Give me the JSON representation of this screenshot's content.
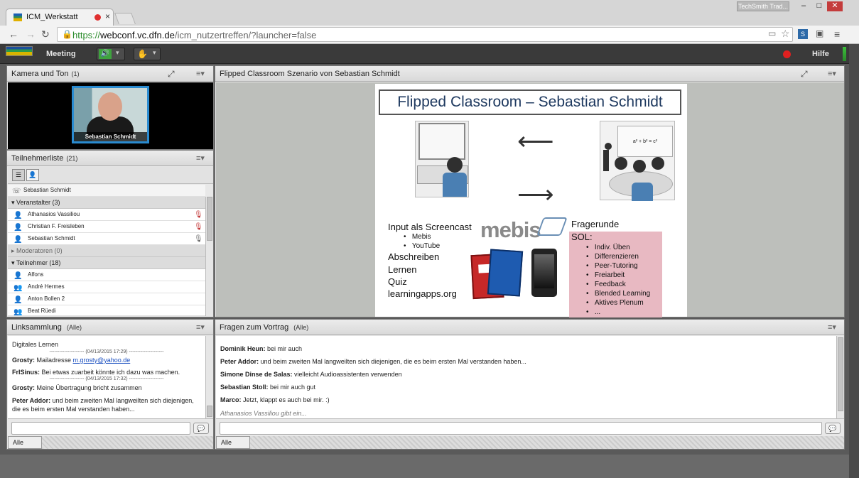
{
  "browser": {
    "tab_title": "ICM_Werkstatt",
    "tab_close": "×",
    "techsmith_label": "TechSmith Trad...",
    "url_scheme": "https://",
    "url_host": "webconf.vc.dfn.de",
    "url_path": "/icm_nutzertreffen/?launcher=false"
  },
  "menubar": {
    "meeting_label": "Meeting",
    "help_label": "Hilfe"
  },
  "camera_pod": {
    "title": "Kamera und Ton",
    "count": "(1)",
    "video_name": "Sebastian Schmidt"
  },
  "attendee_pod": {
    "title": "Teilnehmerliste",
    "count": "(21)",
    "presenter_name": "Sebastian Schmidt",
    "groups": [
      {
        "label": "Veranstalter (3)",
        "expanded": true
      },
      {
        "label": "Moderatoren (0)",
        "expanded": false
      },
      {
        "label": "Teilnehmer (18)",
        "expanded": true
      }
    ],
    "hosts": [
      "Athanasios Vassiliou",
      "Christian F. Freisleben",
      "Sebastian Schmidt"
    ],
    "participants": [
      "Alfons",
      "André Hermes",
      "Anton Bollen 2",
      "Beat Rüedi"
    ]
  },
  "presentation_pod": {
    "title": "Flipped Classroom Szenario von Sebastian Schmidt",
    "slide": {
      "title": "Flipped Classroom – Sebastian Schmidt",
      "left_heading": "Input als Screencast",
      "left_bullets": [
        "Mebis",
        "YouTube"
      ],
      "left_lines": [
        "Abschreiben",
        "Lernen",
        "Quiz",
        "learningapps.org"
      ],
      "logo_text": "mebis",
      "right_heading": "Fragerunde",
      "sol_label": "SOL:",
      "sol_bullets": [
        "Indiv. Üben",
        "Differenzieren",
        "Peer-Tutoring",
        "Freiarbeit",
        "Feedback",
        "Blended Learning",
        "Aktives Plenum",
        "..."
      ],
      "board_formula": "a² + b² = c²"
    }
  },
  "link_pod": {
    "title": "Linksammlung",
    "scope": "(Alle)",
    "heading": "Digitales Lernen",
    "sep1": "--------------------- (04/13/2015 17:29) ---------------------",
    "m1_user": "Grosty:",
    "m1_text": " Mailadresse ",
    "m1_link": "m.grosty@yahoo.de",
    "m2_user": "FrISinus:",
    "m2_text": " Bei etwas zuarbeit könnte ich dazu was machen.",
    "sep2": "--------------------- (04/13/2015 17:32) ---------------------",
    "m3_user": "Grosty:",
    "m3_text": " Meine Übertragung bricht zusammen",
    "m4_user": "Peter Addor:",
    "m4_text": " und beim zweiten Mal langweilten sich diejenigen, die es beim ersten Mal verstanden haben...",
    "tab_all": "Alle"
  },
  "questions_pod": {
    "title": "Fragen zum Vortrag",
    "scope": "(Alle)",
    "messages": [
      {
        "user": "Dominik Heun:",
        "text": " bei mir auch"
      },
      {
        "user": "Peter Addor:",
        "text": " und beim zweiten Mal langweilten sich diejenigen, die es beim ersten Mal verstanden haben..."
      },
      {
        "user": "Simone Dinse de Salas:",
        "text": " vielleicht Audioassistenten verwenden"
      },
      {
        "user": "Sebastian Stoll:",
        "text": " bei mir auch gut"
      },
      {
        "user": "Marco:",
        "text": " Jetzt, klappt es auch bei mir. :)"
      }
    ],
    "typing": "Athanasios Vassiliou gibt ein...",
    "tab_all": "Alle"
  },
  "colors": {
    "accent_blue": "#2a8bd0",
    "record_red": "#e02020",
    "secure_green": "#2a8b2a",
    "sol_box": "#e8b9c2"
  },
  "icons": [
    "audio-speaker-icon",
    "webcam-icon",
    "record-icon",
    "expand-icon",
    "pod-menu-icon",
    "phone-icon",
    "user-icon",
    "muted-mic-icon",
    "send-chat-icon"
  ]
}
